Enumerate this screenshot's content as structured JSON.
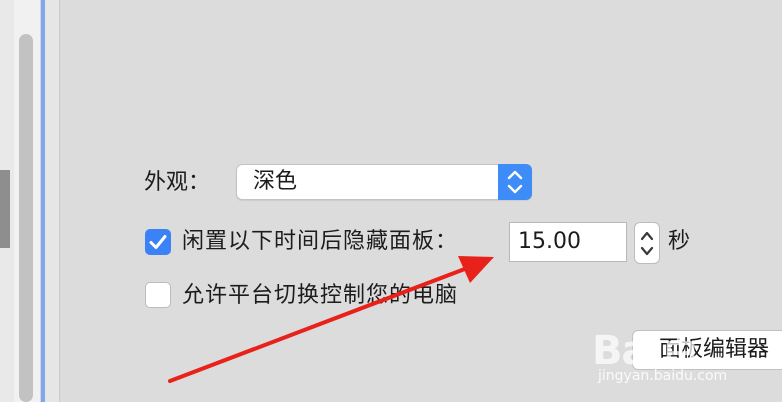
{
  "settings": {
    "appearance_label": "外观：",
    "appearance_value": "深色",
    "appearance_selector_icon": "up-down-chevrons-icon",
    "hide_panel_label": "闲置以下时间后隐藏面板：",
    "hide_panel_checked": true,
    "idle_time_value": "15.00",
    "idle_time_unit": "秒",
    "allow_platform_label": "允许平台切换控制您的电脑",
    "allow_platform_checked": false,
    "panel_editor_button_label": "面板编辑器"
  },
  "annotation": {
    "arrow_color": "#e8221b",
    "arrow_icon": "red-arrow-annotation"
  },
  "watermark": {
    "logo_text": "Bai百",
    "url_text": "jingyan.baidu.com"
  },
  "colors": {
    "accent": "#3d8cf7",
    "sidebar_bar": "#7fa6ee",
    "background": "#dcdcdc"
  }
}
